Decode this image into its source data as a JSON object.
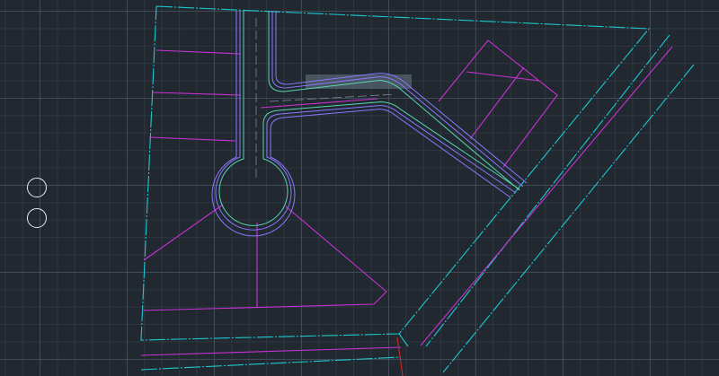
{
  "app": {
    "viewport": "cad-drawing-canvas"
  },
  "colors": {
    "background": "#212830",
    "parcel_boundary": "#1ec8d0",
    "lot_lines": "#c832d6",
    "road_centerline": "#58d6b0",
    "road_edge": "#8a78ff",
    "highlight": "#7a8898",
    "section_line": "#d0282c",
    "tool_circle": "#e8ecef"
  },
  "tools": [
    {
      "name": "nav-zoom-in-circle",
      "icon": "circle-icon"
    },
    {
      "name": "nav-zoom-out-circle",
      "icon": "circle-icon"
    }
  ]
}
